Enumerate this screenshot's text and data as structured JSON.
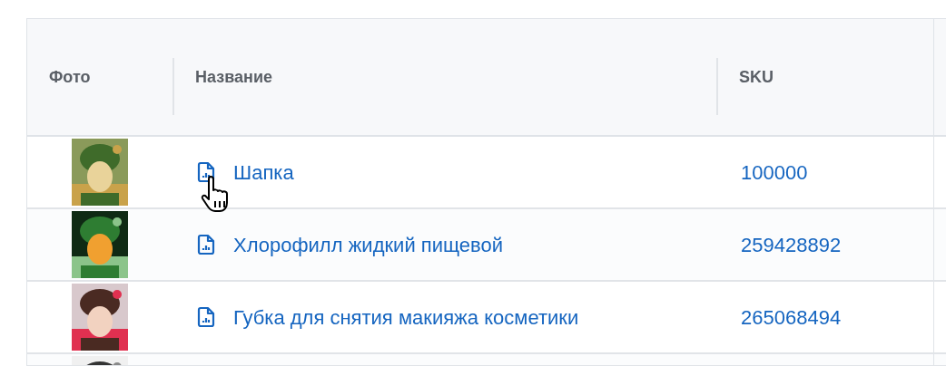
{
  "table": {
    "columns": [
      "Фото",
      "Название",
      "SKU"
    ],
    "rows": [
      {
        "photo": {
          "kind": "picture"
        },
        "name": "Шапка",
        "sku": "100000",
        "hovered": true
      },
      {
        "photo": {
          "kind": "picture"
        },
        "name": "Хлорофилл жидкий пищевой",
        "sku": "259428892",
        "hovered": false
      },
      {
        "photo": {
          "kind": "picture"
        },
        "name": "Губка для снятия макияжа косметики",
        "sku": "265068494",
        "hovered": false
      },
      {
        "photo": {
          "kind": "picture"
        }
      }
    ]
  }
}
